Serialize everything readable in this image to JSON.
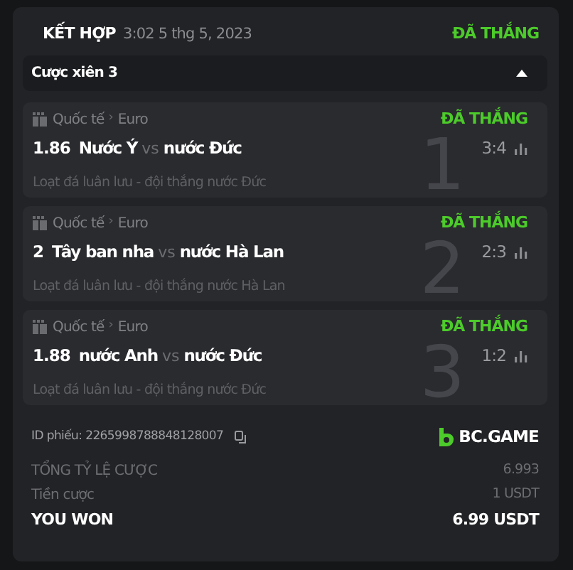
{
  "header": {
    "title": "KẾT HỢP",
    "datetime": "3:02 5 thg 5, 2023",
    "status": "ĐÃ THẮNG"
  },
  "parlay": {
    "label": "Cược xiên 3",
    "expanded": true
  },
  "legs": [
    {
      "number": "1",
      "league": "Quốc tế",
      "separator": "›",
      "tournament": "Euro",
      "status": "ĐÃ THẮNG",
      "odds": "1.86",
      "home": "Nước Ý",
      "vs": "vs",
      "away": "nước Đức",
      "score": "3:4",
      "market": "Loạt đá luân lưu - đội thắng nước Đức"
    },
    {
      "number": "2",
      "league": "Quốc tế",
      "separator": "›",
      "tournament": "Euro",
      "status": "ĐÃ THẮNG",
      "odds": "2",
      "home": "Tây ban nha",
      "vs": "vs",
      "away": "nước Hà Lan",
      "score": "2:3",
      "market": "Loạt đá luân lưu - đội thắng nước Hà Lan"
    },
    {
      "number": "3",
      "league": "Quốc tế",
      "separator": "›",
      "tournament": "Euro",
      "status": "ĐÃ THẮNG",
      "odds": "1.88",
      "home": "nước Anh",
      "vs": "vs",
      "away": "nước Đức",
      "score": "1:2",
      "market": "Loạt đá luân lưu - đội thắng nước Đức"
    }
  ],
  "ticket": {
    "id_label": "ID phiếu: 2265998788848128007",
    "brand": "BC.GAME"
  },
  "summary": [
    {
      "kind": "normal",
      "label": "TỔNG TỶ LỆ CƯỢC",
      "value": "6.993"
    },
    {
      "kind": "normal",
      "label": "Tiền cược",
      "value": "1 USDT"
    },
    {
      "kind": "total",
      "label": "YOU WON",
      "value": "6.99 USDT"
    }
  ]
}
